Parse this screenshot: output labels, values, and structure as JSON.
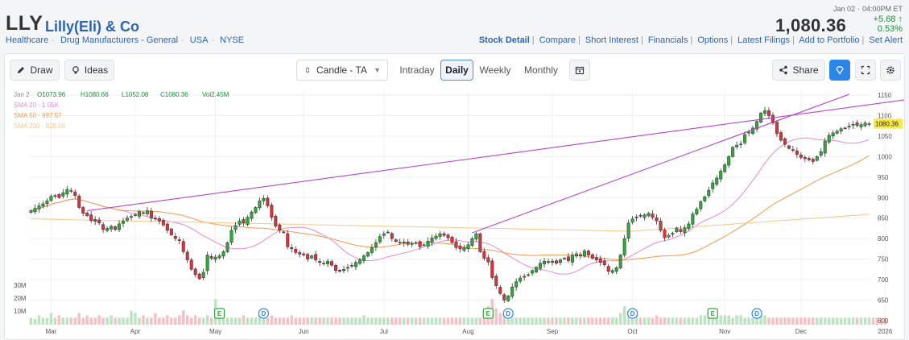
{
  "quote": {
    "ticker": "LLY",
    "company": "Lilly(Eli) & Co",
    "meta": [
      "Healthcare",
      "Drug Manufacturers - General",
      "USA",
      "NYSE"
    ],
    "date": "Jan 02",
    "time": "04:00PM ET",
    "price": "1,080.36",
    "change": "+5.68",
    "change_arrow": "↑",
    "change_pct": "0.53%",
    "links": [
      "Stock Detail",
      "Compare",
      "Short Interest",
      "Financials",
      "Options",
      "Latest Filings",
      "Add to Portfolio",
      "Set Alert"
    ]
  },
  "toolbar": {
    "draw": "Draw",
    "ideas": "Ideas",
    "chart_type": "Candle - TA",
    "tabs": [
      "Intraday",
      "Daily",
      "Weekly",
      "Monthly"
    ],
    "active_tab": "Daily",
    "share": "Share"
  },
  "colors": {
    "up": "#2ea83a",
    "down": "#d9333f",
    "sma20": "#e58ad1",
    "sma50": "#f2994a",
    "sma200": "#f3c98b",
    "trendline": "#b347c6",
    "link": "#2b63b3"
  },
  "chart_data": {
    "type": "candlestick",
    "ohlc_label": {
      "date": "Jan 2",
      "o": "O1073.96",
      "h": "H1080.66",
      "l": "L1052.08",
      "c": "C1080.36",
      "vol": "Vol2.45M"
    },
    "sma_labels": [
      {
        "text": "SMA 20 · 1.05K",
        "color": "#e58ad1"
      },
      {
        "text": "SMA 50 · 997.57",
        "color": "#f2994a"
      },
      {
        "text": "SMA 200 · 828.06",
        "color": "#f3c98b"
      }
    ],
    "y_ticks": [
      1150,
      1100,
      1050,
      1000,
      950,
      900,
      850,
      800,
      750,
      700,
      650,
      600
    ],
    "y_range": [
      590,
      1160
    ],
    "last_price_tag": "1080.36",
    "volume_ticks": [
      "30M",
      "20M",
      "10M"
    ],
    "x_months": [
      {
        "label": "Mar",
        "i": 5
      },
      {
        "label": "Apr",
        "i": 26
      },
      {
        "label": "May",
        "i": 46
      },
      {
        "label": "Jun",
        "i": 68
      },
      {
        "label": "Jul",
        "i": 88
      },
      {
        "label": "Aug",
        "i": 109
      },
      {
        "label": "Sep",
        "i": 130
      },
      {
        "label": "Oct",
        "i": 150
      },
      {
        "label": "Nov",
        "i": 173
      },
      {
        "label": "Dec",
        "i": 192
      },
      {
        "label": "2026",
        "i": 213
      }
    ],
    "markers": [
      {
        "type": "E",
        "i": 47
      },
      {
        "type": "D",
        "i": 58
      },
      {
        "type": "E",
        "i": 114
      },
      {
        "type": "D",
        "i": 119
      },
      {
        "type": "D",
        "i": 150
      },
      {
        "type": "E",
        "i": 170
      },
      {
        "type": "D",
        "i": 181
      }
    ],
    "closes": [
      868,
      874,
      880,
      885,
      892,
      903,
      905,
      900,
      912,
      920,
      916,
      905,
      876,
      862,
      856,
      844,
      842,
      838,
      822,
      825,
      830,
      822,
      836,
      843,
      850,
      854,
      858,
      866,
      862,
      868,
      850,
      848,
      843,
      833,
      820,
      809,
      800,
      795,
      768,
      748,
      725,
      712,
      702,
      718,
      760,
      752,
      755,
      758,
      768,
      790,
      820,
      832,
      843,
      838,
      852,
      865,
      876,
      892,
      898,
      880,
      852,
      830,
      820,
      815,
      780,
      775,
      766,
      762,
      760,
      750,
      758,
      748,
      742,
      740,
      745,
      735,
      722,
      720,
      725,
      730,
      735,
      742,
      748,
      758,
      766,
      778,
      790,
      805,
      812,
      816,
      800,
      793,
      790,
      792,
      786,
      788,
      790,
      780,
      785,
      794,
      802,
      806,
      812,
      808,
      802,
      790,
      778,
      775,
      778,
      785,
      800,
      812,
      768,
      752,
      743,
      705,
      685,
      666,
      650,
      660,
      682,
      695,
      704,
      708,
      712,
      722,
      730,
      740,
      745,
      742,
      745,
      740,
      748,
      752,
      746,
      760,
      763,
      758,
      770,
      760,
      752,
      748,
      742,
      736,
      720,
      722,
      729,
      760,
      800,
      838,
      848,
      853,
      855,
      858,
      862,
      852,
      843,
      820,
      802,
      808,
      813,
      826,
      817,
      826,
      836,
      860,
      872,
      890,
      902,
      918,
      936,
      948,
      965,
      980,
      1000,
      1023,
      1028,
      1031,
      1054,
      1060,
      1070,
      1086,
      1106,
      1112,
      1100,
      1082,
      1056,
      1040,
      1030,
      1020,
      1016,
      1005,
      998,
      995,
      992,
      988,
      1000,
      1012,
      1038,
      1052,
      1058,
      1062,
      1068,
      1070,
      1074,
      1079,
      1076,
      1078,
      1082,
      1080.36
    ],
    "volume": [
      3,
      2.5,
      4,
      3,
      3,
      5,
      3,
      4,
      3,
      3,
      3,
      3,
      5,
      3,
      4,
      3,
      3,
      4,
      3,
      3,
      4,
      3,
      3,
      3,
      3,
      6,
      5,
      3,
      4,
      3,
      3,
      5,
      3,
      3,
      4,
      3,
      3,
      4,
      6,
      4,
      3,
      4,
      3,
      3,
      4,
      3,
      11,
      4,
      3,
      3,
      3,
      3,
      3,
      4,
      3,
      3,
      3,
      4,
      3,
      3,
      4,
      3,
      3,
      3,
      3,
      4,
      3,
      3,
      3,
      3,
      3,
      3,
      3,
      3,
      3,
      3,
      3,
      3,
      3,
      3,
      3,
      3,
      3,
      4,
      3,
      3,
      3,
      3,
      3,
      3,
      3,
      3,
      3,
      3,
      3,
      3,
      3,
      3,
      3,
      3,
      3,
      3,
      3,
      3,
      3,
      3,
      3,
      3,
      3,
      3,
      3,
      3,
      3,
      6,
      8,
      11,
      7,
      5,
      4,
      4,
      3,
      3,
      3,
      3,
      3,
      3,
      3,
      3,
      3,
      3,
      3,
      3,
      3,
      3,
      3,
      3,
      3,
      3,
      3,
      3,
      3,
      3,
      3,
      3,
      3,
      3,
      3,
      5,
      8,
      6,
      4,
      4,
      3,
      3,
      3,
      3,
      4,
      3,
      3,
      3,
      3,
      3,
      3,
      3,
      3,
      3,
      3,
      4,
      4,
      5,
      6,
      4,
      4,
      4,
      4,
      3,
      4,
      4,
      3,
      3,
      3,
      4,
      4,
      4,
      3,
      3,
      3,
      3,
      3,
      3,
      3,
      3,
      3,
      3,
      3,
      3,
      3,
      3,
      3,
      3,
      3,
      3,
      3,
      3,
      3,
      3,
      3,
      3,
      3,
      3,
      3,
      3,
      3,
      3
    ],
    "trendlines": [
      {
        "i1": 14,
        "v1": 868,
        "i2": 222,
        "v2": 1144
      },
      {
        "i1": 110,
        "v1": 814,
        "i2": 204,
        "v2": 1152
      }
    ]
  }
}
